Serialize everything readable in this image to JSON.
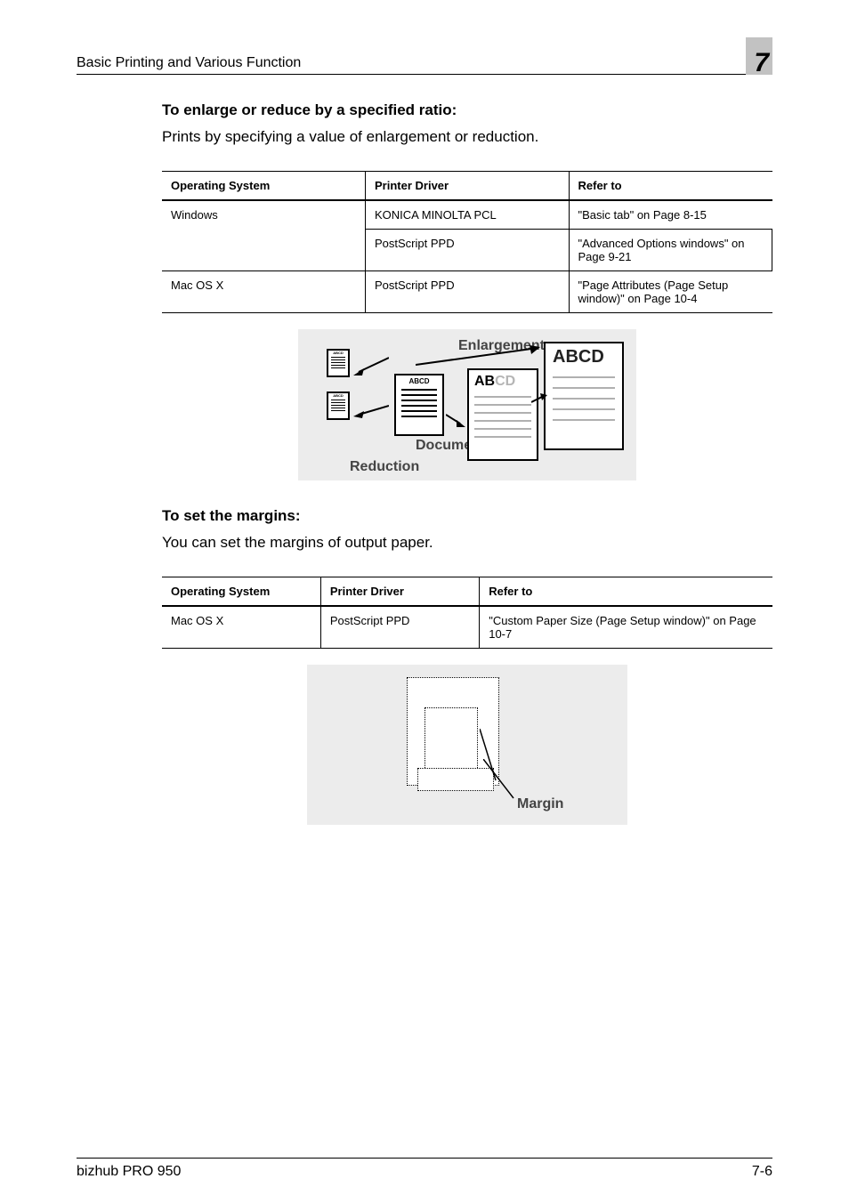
{
  "header": {
    "left": "Basic Printing and Various Function",
    "page_tab": "7"
  },
  "section1": {
    "title": "To enlarge or reduce by a specified ratio:",
    "para": "Prints by specifying a value of enlargement or reduction.",
    "table": {
      "headers": [
        "Operating System",
        "Printer Driver",
        "Refer to"
      ],
      "rows": [
        [
          "Windows",
          "KONICA MINOLTA PCL",
          "\"Basic tab\" on Page 8-15"
        ],
        [
          "",
          "PostScript PPD",
          "\"Advanced Options windows\" on Page 9-21"
        ],
        [
          "Mac OS X",
          "PostScript PPD",
          "\"Page Attributes (Page Setup window)\" on Page 10-4"
        ]
      ]
    },
    "illust": {
      "enlargement": "Enlargement",
      "document": "Document",
      "reduction": "Reduction",
      "abcd": "ABCD",
      "ab": "AB",
      "cd": "CD"
    }
  },
  "section2": {
    "title": "To set the margins:",
    "para": "You can set the margins of output paper.",
    "table": {
      "headers": [
        "Operating System",
        "Printer Driver",
        "Refer to"
      ],
      "rows": [
        [
          "Mac OS X",
          "PostScript PPD",
          "\"Custom Paper Size (Page Setup window)\" on Page 10-7"
        ]
      ]
    },
    "illust": {
      "margin": "Margin"
    }
  },
  "footer": {
    "left": "bizhub PRO 950",
    "right": "7-6"
  }
}
